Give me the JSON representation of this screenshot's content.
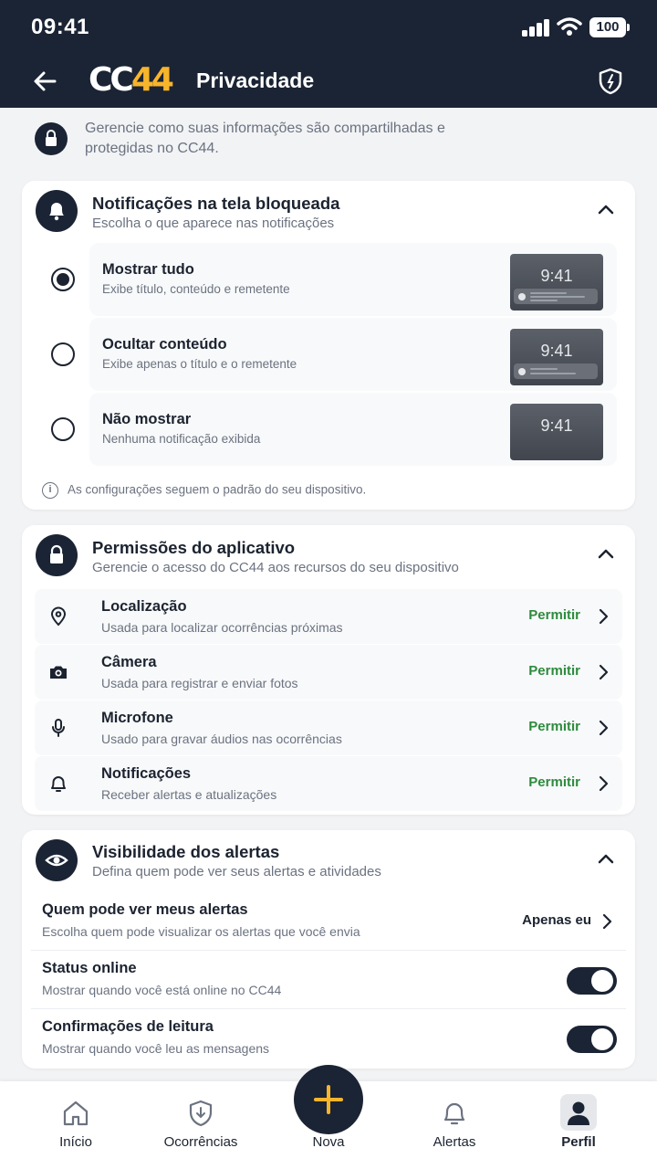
{
  "status_bar": {
    "time": "09:41",
    "battery": "100"
  },
  "header": {
    "logo_cc": "CC",
    "logo_44": "44",
    "title": "Privacidade"
  },
  "intro": {
    "text": "Gerencie como suas informações são compartilhadas e protegidas no CC44."
  },
  "notifications_card": {
    "title": "Notificações na tela bloqueada",
    "subtitle": "Escolha o que aparece nas notificações",
    "options": [
      {
        "title": "Mostrar tudo",
        "subtitle": "Exibe título, conteúdo e remetente",
        "preview_time": "9:41",
        "selected": true
      },
      {
        "title": "Ocultar conteúdo",
        "subtitle": "Exibe apenas o título e o remetente",
        "preview_time": "9:41",
        "selected": false
      },
      {
        "title": "Não mostrar",
        "subtitle": "Nenhuma notificação exibida",
        "preview_time": "9:41",
        "selected": false
      }
    ],
    "info_icon": "i",
    "note": "As configurações seguem o padrão do seu dispositivo."
  },
  "permissions_card": {
    "title": "Permissões do aplicativo",
    "subtitle": "Gerencie o acesso do CC44 aos recursos do seu dispositivo",
    "items": [
      {
        "icon": "location-pin-icon",
        "title": "Localização",
        "subtitle": "Usada para localizar ocorrências próximas",
        "action": "Permitir"
      },
      {
        "icon": "camera-icon",
        "title": "Câmera",
        "subtitle": "Usada para registrar e enviar fotos",
        "action": "Permitir"
      },
      {
        "icon": "microphone-icon",
        "title": "Microfone",
        "subtitle": "Usado para gravar áudios nas ocorrências",
        "action": "Permitir"
      },
      {
        "icon": "bell-icon",
        "title": "Notificações",
        "subtitle": "Receber alertas e atualizações",
        "action": "Permitir"
      }
    ]
  },
  "visibility_card": {
    "title": "Visibilidade dos alertas",
    "subtitle": "Defina quem pode ver seus alertas e atividades",
    "who_can_see": {
      "title": "Quem pode ver meus alertas",
      "subtitle": "Escolha quem pode visualizar os alertas que você envia",
      "value": "Apenas eu"
    },
    "online_status": {
      "title": "Status online",
      "subtitle": "Mostrar quando você está online no CC44",
      "enabled": true
    },
    "read_receipts": {
      "title": "Confirmações de leitura",
      "subtitle": "Mostrar quando você leu as mensagens",
      "enabled": true
    }
  },
  "bottom_nav": {
    "items": [
      {
        "label": "Início",
        "icon": "home-icon"
      },
      {
        "label": "Ocorrências",
        "icon": "shield-icon"
      },
      {
        "label": "Nova",
        "icon": "plus-icon"
      },
      {
        "label": "Alertas",
        "icon": "bell-icon"
      },
      {
        "label": "Perfil",
        "icon": "person-icon",
        "active": true
      }
    ]
  },
  "colors": {
    "header_bg": "#1b2434",
    "accent_yellow": "#f7b52c",
    "permit_green": "#2e8b3e",
    "page_bg": "#f2f3f5"
  }
}
